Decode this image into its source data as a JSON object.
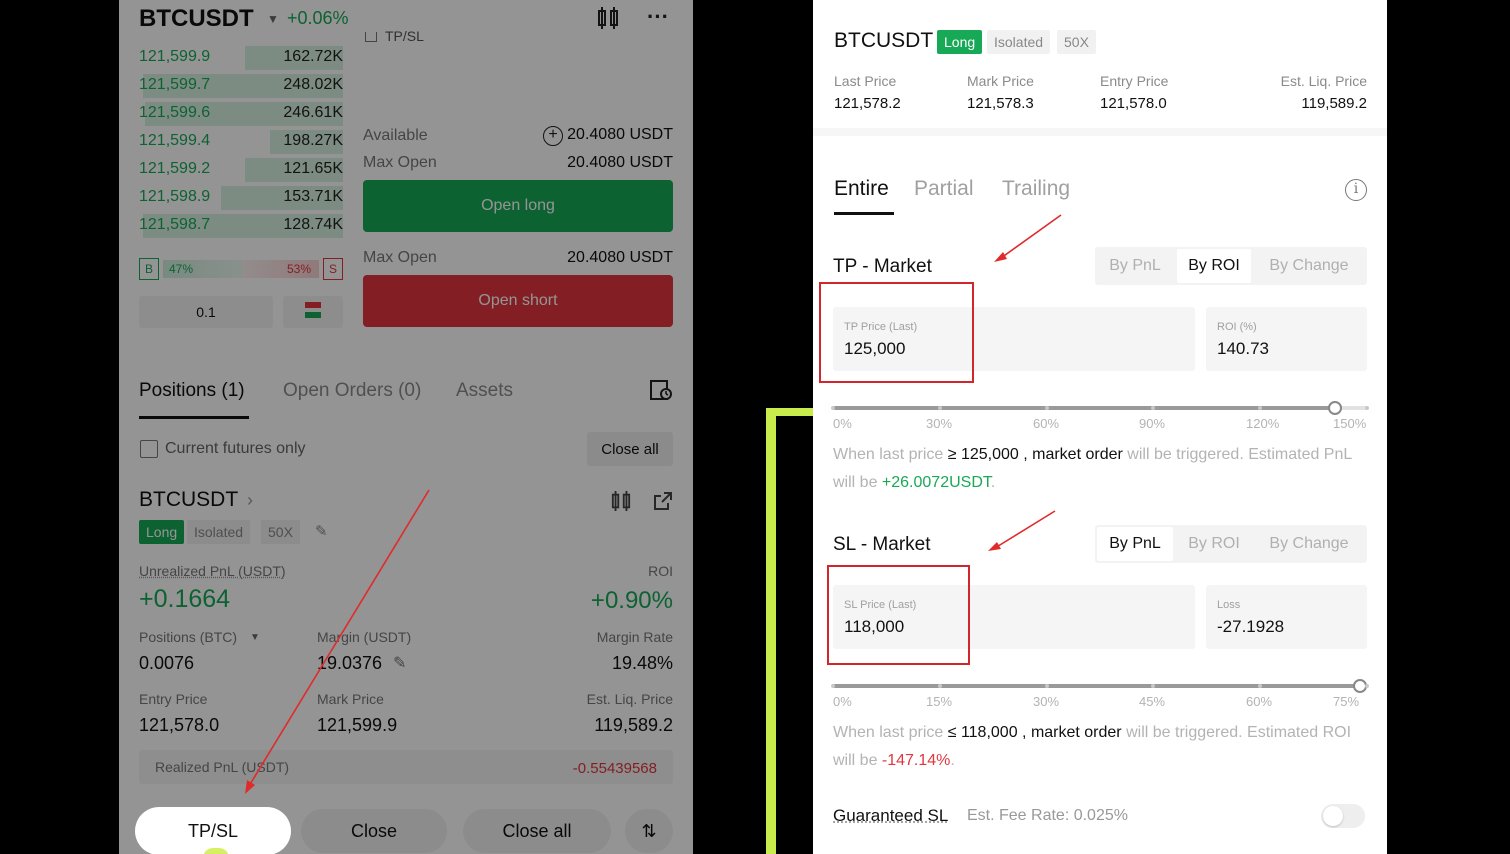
{
  "left": {
    "symbol": "BTCUSDT",
    "change": "+0.06%",
    "orderbook": [
      {
        "price": "121,599.9",
        "qty": "162.72K",
        "fill": 0.48
      },
      {
        "price": "121,599.7",
        "qty": "248.02K",
        "fill": 0.98
      },
      {
        "price": "121,599.6",
        "qty": "246.61K",
        "fill": 0.97
      },
      {
        "price": "121,599.4",
        "qty": "198.27K",
        "fill": 0.36
      },
      {
        "price": "121,599.2",
        "qty": "121.65K",
        "fill": 0.48
      },
      {
        "price": "121,598.9",
        "qty": "153.71K",
        "fill": 0.6
      },
      {
        "price": "121,598.7",
        "qty": "128.74K",
        "fill": 0.98
      }
    ],
    "tpsl_checkbox_label": "TP/SL",
    "buy_marker": "B",
    "buy_pct": "47%",
    "sell_pct": "53%",
    "sell_marker": "S",
    "precision": "0.1",
    "available_label": "Available",
    "available_value": "20.4080 USDT",
    "max_open_label": "Max Open",
    "max_open_value": "20.4080 USDT",
    "open_long": "Open long",
    "max_open_label_2": "Max Open",
    "max_open_value_2": "20.4080 USDT",
    "open_short": "Open short",
    "tabs": [
      "Positions (1)",
      "Open Orders (0)",
      "Assets"
    ],
    "current_futures_only": "Current futures only",
    "close_all_btn": "Close all",
    "position": {
      "symbol": "BTCUSDT",
      "side": "Long",
      "margin_mode": "Isolated",
      "leverage": "50X",
      "unrealized_label": "Unrealized PnL (USDT)",
      "unrealized_value": "+0.1664",
      "roi_label": "ROI",
      "roi_value": "+0.90%",
      "positions_label": "Positions (BTC)",
      "positions_value": "0.0076",
      "margin_label": "Margin (USDT)",
      "margin_value": "19.0376",
      "margin_rate_label": "Margin Rate",
      "margin_rate_value": "19.48%",
      "entry_label": "Entry Price",
      "entry_value": "121,578.0",
      "mark_label": "Mark Price",
      "mark_value": "121,599.9",
      "liq_label": "Est. Liq. Price",
      "liq_value": "119,589.2",
      "realized_label": "Realized PnL (USDT)",
      "realized_value": "-0.55439568"
    },
    "actions": [
      "TP/SL",
      "Close",
      "Close all"
    ]
  },
  "right": {
    "symbol": "BTCUSDT",
    "side": "Long",
    "margin_mode": "Isolated",
    "leverage": "50X",
    "last_price_label": "Last Price",
    "last_price": "121,578.2",
    "mark_price_label": "Mark Price",
    "mark_price": "121,578.3",
    "entry_price_label": "Entry Price",
    "entry_price": "121,578.0",
    "liq_label": "Est. Liq. Price",
    "liq_price": "119,589.2",
    "tabs": [
      "Entire",
      "Partial",
      "Trailing"
    ],
    "tp": {
      "title": "TP - Market",
      "modes": [
        "By PnL",
        "By ROI",
        "By Change"
      ],
      "active_mode": 1,
      "price_label": "TP Price (Last)",
      "price_value": "125,000",
      "metric_label": "ROI (%)",
      "metric_value": "140.73",
      "ticks": [
        "0%",
        "30%",
        "60%",
        "90%",
        "120%",
        "150%"
      ],
      "slider_fraction": 0.94,
      "desc_pre": "When last price",
      "desc_cond": "≥ 125,000",
      "desc_mid": ", market order",
      "desc_post": " will be triggered. Estimated PnL will be ",
      "desc_value": "+26.0072USDT",
      "desc_end": "."
    },
    "sl": {
      "title": "SL - Market",
      "modes": [
        "By PnL",
        "By ROI",
        "By Change"
      ],
      "active_mode": 0,
      "price_label": "SL Price (Last)",
      "price_value": "118,000",
      "metric_label": "Loss",
      "metric_value": "-27.1928",
      "ticks": [
        "0%",
        "15%",
        "30%",
        "45%",
        "60%",
        "75%"
      ],
      "slider_fraction": 1.0,
      "desc_pre": "When last price",
      "desc_cond": "≤ 118,000",
      "desc_mid": ", market order",
      "desc_post": " will be triggered. Estimated ROI will be ",
      "desc_value": "-147.14%",
      "desc_end": "."
    },
    "guaranteed_sl_label": "Guaranteed SL",
    "fee_rate": "Est. Fee Rate: 0.025%"
  },
  "colors": {
    "green": "#18a957",
    "red": "#e2363f",
    "orange": "#e69a00",
    "annotation": "#d0262c",
    "frame": "#c7ec4c"
  }
}
